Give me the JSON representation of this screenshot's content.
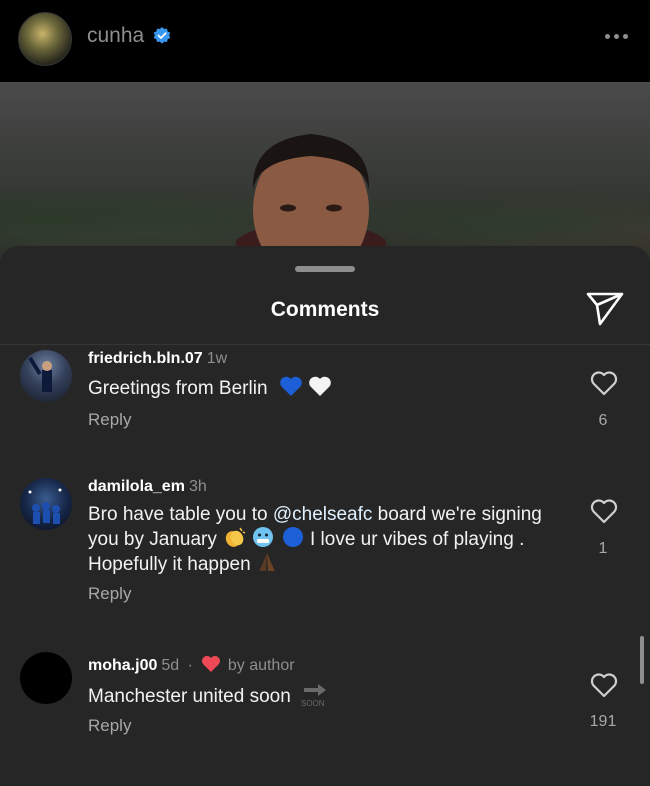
{
  "header": {
    "username": "cunha",
    "verified_icon": "verified-badge-icon",
    "more_icon": "more-options-icon"
  },
  "sheet": {
    "title": "Comments",
    "send_icon": "send-icon"
  },
  "comments": [
    {
      "username": "friedrich.bln.07",
      "time": "1w",
      "text": "Greetings from Berlin",
      "emojis": [
        "blue-heart",
        "white-heart"
      ],
      "reply_label": "Reply",
      "likes": "6"
    },
    {
      "username": "damilola_em",
      "time": "3h",
      "text_part1": "Bro have table you to ",
      "mention": "@chelseafc",
      "text_part2": " board we're signing you by January ",
      "text_part3": " I love ur vibes of playing . Hopefully it happen",
      "emojis": [
        "clapping-hands",
        "cold-face",
        "blue-circle",
        "folded-hands"
      ],
      "reply_label": "Reply",
      "likes": "1"
    },
    {
      "username": "moha.j00",
      "time": "5d",
      "separator": "·",
      "by_author": "by author",
      "text": "Manchester united soon",
      "emojis": [
        "soon-arrow"
      ],
      "reply_label": "Reply",
      "likes": "191"
    }
  ],
  "colors": {
    "sheet_bg": "#262626",
    "muted": "#8e8e8e",
    "verified_blue": "#3897f0",
    "author_heart": "#ed4956",
    "mention": "#e0f1ff"
  }
}
